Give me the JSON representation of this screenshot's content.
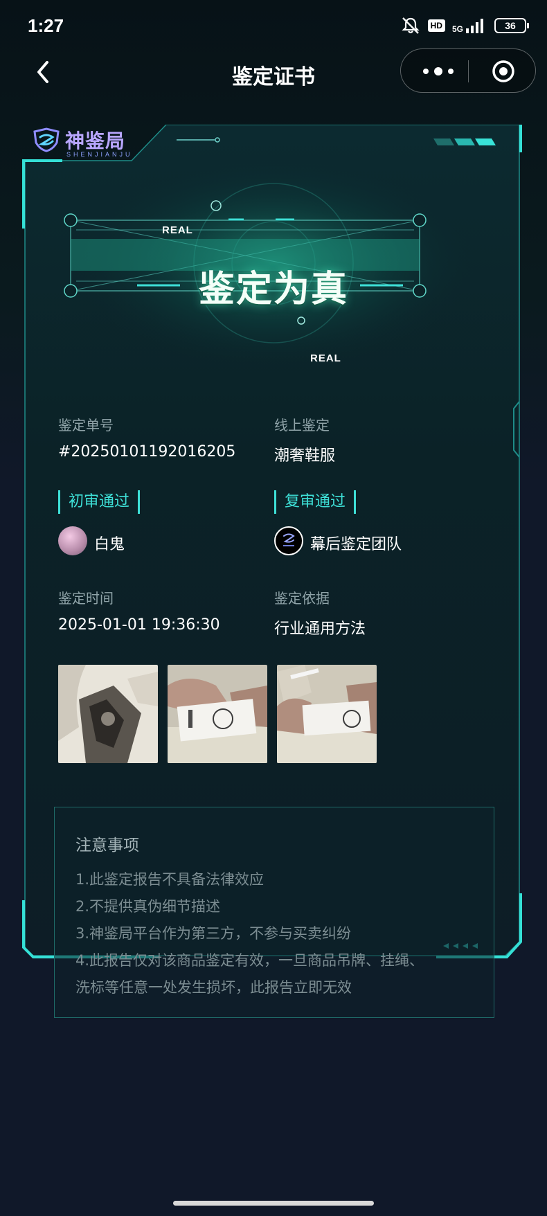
{
  "status_bar": {
    "time": "1:27",
    "hd": "HD",
    "network": "5G",
    "battery": "36"
  },
  "nav": {
    "title": "鉴定证书"
  },
  "brand": {
    "name": "神鉴局",
    "sub": "SHENJIANJU"
  },
  "result": {
    "tag_top": "REAL",
    "tag_bottom": "REAL",
    "verdict": "鉴定为真"
  },
  "info": {
    "order_label": "鉴定单号",
    "order_value": "#20250101192016205",
    "mode_label": "线上鉴定",
    "mode_value": "潮奢鞋服",
    "first_review": "初审通过",
    "second_review": "复审通过",
    "first_appraiser": "白鬼",
    "second_appraiser": "幕后鉴定团队",
    "time_label": "鉴定时间",
    "time_value": "2025-01-01 19:36:30",
    "basis_label": "鉴定依据",
    "basis_value": "行业通用方法"
  },
  "photos": [
    "garment-print-photo",
    "wash-label-photo-1",
    "wash-label-photo-2"
  ],
  "notice": {
    "title": "注意事项",
    "lines": [
      "1.此鉴定报告不具备法律效应",
      "2.不提供真伪细节描述",
      "3.神鉴局平台作为第三方，不参与买卖纠纷",
      "4.此报告仅对该商品鉴定有效，一旦商品吊牌、挂绳、",
      "洗标等任意一处发生损坏，此报告立即无效"
    ]
  },
  "colors": {
    "accent": "#3ee0d7",
    "frame": "#27c7c0",
    "background": "#101829",
    "brand": "#b9a7ff"
  }
}
